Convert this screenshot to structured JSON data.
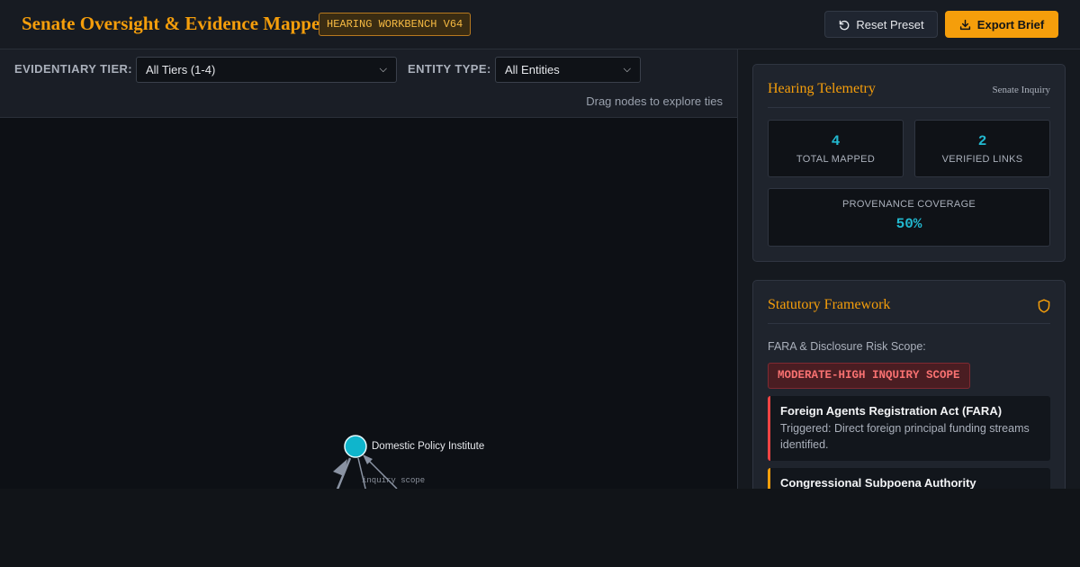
{
  "header": {
    "title": "Senate Oversight & Evidence Mapper",
    "badge": "HEARING WORKBENCH V64",
    "reset_label": "Reset Preset",
    "export_label": "Export Brief"
  },
  "filters": {
    "tier_label": "EVIDENTIARY TIER:",
    "tier_value": "All Tiers (1-4)",
    "entity_label": "ENTITY TYPE:",
    "entity_value": "All Entities",
    "hint": "Drag nodes to explore ties"
  },
  "graph": {
    "node_label": "Domestic Policy Institute",
    "edge_label": "inquiry scope",
    "node_color": "#0fb5cc",
    "edge_color": "#8a93a3"
  },
  "telemetry": {
    "title": "Hearing Telemetry",
    "meta": "Senate Inquiry",
    "total_mapped_value": "4",
    "total_mapped_label": "TOTAL MAPPED",
    "verified_links_value": "2",
    "verified_links_label": "VERIFIED LINKS",
    "coverage_label": "PROVENANCE COVERAGE",
    "coverage_value": "50%"
  },
  "statutory": {
    "title": "Statutory Framework",
    "icon": "shield-icon",
    "scope_label": "FARA & Disclosure Risk Scope:",
    "risk_badge": "MODERATE-HIGH INQUIRY SCOPE",
    "statutes": [
      {
        "name": "Foreign Agents Registration Act (FARA)",
        "desc": "Triggered: Direct foreign principal funding streams identified.",
        "color": "#ef4444"
      },
      {
        "name": "Congressional Subpoena Authority",
        "desc": "",
        "color": "#f59e0b"
      }
    ]
  },
  "colors": {
    "accent": "#f59e0b",
    "teal": "#22b8cf",
    "danger": "#f87171"
  }
}
